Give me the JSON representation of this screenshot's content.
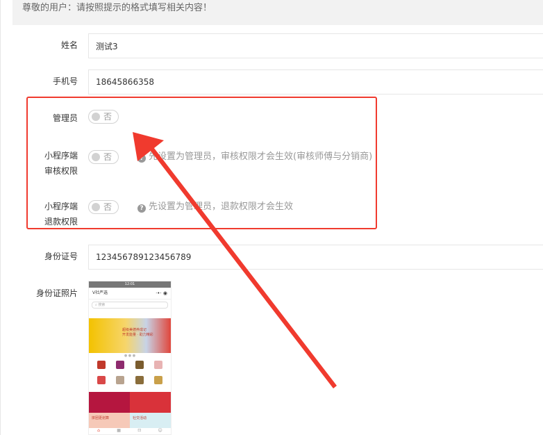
{
  "notice": "尊敬的用户：请按照提示的格式填写相关内容！",
  "fields": {
    "name": {
      "label": "姓名",
      "value": "测试3"
    },
    "phone": {
      "label": "手机号",
      "value": "18645866358"
    },
    "admin": {
      "label": "管理员",
      "state": "否"
    },
    "miniapp_audit": {
      "label_line1": "小程序端",
      "label_line2": "审核权限",
      "state": "否",
      "tip": "先设置为管理员，审核权限才会生效(审核师傅与分销商)"
    },
    "miniapp_refund": {
      "label_line1": "小程序端",
      "label_line2": "退款权限",
      "state": "否",
      "tip": "先设置为管理员，退款权限才会生效"
    },
    "id_number": {
      "label": "身份证号",
      "value": "123456789123456789"
    },
    "id_photo": {
      "label": "身份证照片"
    }
  },
  "phone_preview": {
    "status_time": "12:01",
    "title": "V社严选",
    "search_placeholder": "搜索",
    "banner_text_1": "超级美德养成记",
    "banner_text_2": "开发能量 · 助力精彩",
    "promo_text": "拼团更划算",
    "promo_text_2": "社交活动"
  },
  "colors": {
    "highlight": "#f03a2e",
    "arrow": "#f03a2e",
    "switch_off": "#d2d2d2"
  }
}
